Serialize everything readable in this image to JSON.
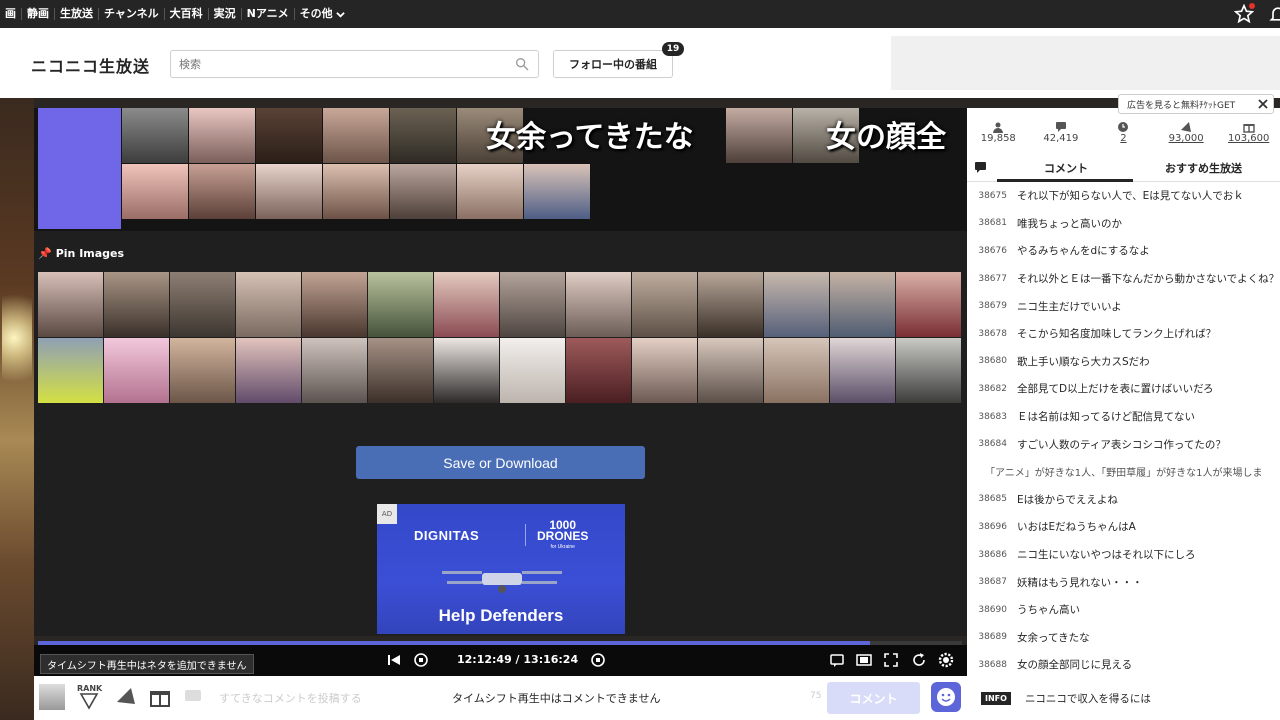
{
  "nav": {
    "items": [
      "画",
      "静画",
      "生放送",
      "チャンネル",
      "大百科",
      "実況",
      "Nアニメ",
      "その他"
    ]
  },
  "header": {
    "logo": "ニコニコ生放送",
    "search_placeholder": "検索",
    "follow_label": "フォロー中の番組",
    "follow_count": "19"
  },
  "player": {
    "overlay_text_1": "女余ってきたな",
    "overlay_text_2": "女の顔全",
    "pin_label": "Pin Images",
    "save_label": "Save or Download",
    "ad": {
      "tag": "AD",
      "brand": "DIGNITAS",
      "drones_line1": "1000",
      "drones_line2": "DRONES",
      "drones_sub": "for Ukraine",
      "tagline": "Help Defenders"
    },
    "progress": 0.9,
    "time": "12:12:49 / 13:16:24",
    "tooltip": "タイムシフト再生中はネタを追加できません"
  },
  "bottom": {
    "rank": "RANK",
    "comment_placeholder": "すてきなコメントを投稿する",
    "no_comment": "タイムシフト再生中はコメントできません",
    "char_count": "75",
    "comment_button": "コメント"
  },
  "side": {
    "ad_ticket": "広告を見ると無料ﾁｹｯﾄGET",
    "stats": [
      {
        "icon": "viewer-icon",
        "value": "19,858"
      },
      {
        "icon": "comment-count-icon",
        "value": "42,419"
      },
      {
        "icon": "timeshift-icon",
        "value": "2"
      },
      {
        "icon": "ad-points-icon",
        "value": "93,000"
      },
      {
        "icon": "gift-icon",
        "value": "103,600"
      }
    ],
    "tabs": [
      "コメント",
      "おすすめ生放送"
    ],
    "comments": [
      {
        "no": "38675",
        "text": "それ以下が知らない人で、Eは見てない人でおｋ"
      },
      {
        "no": "38681",
        "text": "唯我ちょっと高いのか"
      },
      {
        "no": "38676",
        "text": "やるみちゃんをdにするなよ"
      },
      {
        "no": "38677",
        "text": "それ以外とＥは一番下なんだから動かさないでよくね？"
      },
      {
        "no": "38679",
        "text": "ニコ生主だけでいいよ"
      },
      {
        "no": "38678",
        "text": "そこから知名度加味してランク上げれば？"
      },
      {
        "no": "38680",
        "text": "歌上手い順なら大カスSだわ"
      },
      {
        "no": "38682",
        "text": "全部見てD以上だけを表に置けばいいだろ"
      },
      {
        "no": "38683",
        "text": "Ｅは名前は知ってるけど配信見てない"
      },
      {
        "no": "38684",
        "text": "すごい人数のティア表シコシコ作ってたの？"
      },
      {
        "no": "",
        "text": "「アニメ」が好きな1人、「野田草履」が好きな1人が来場しま"
      },
      {
        "no": "38685",
        "text": "Eは後からでええよね"
      },
      {
        "no": "38696",
        "text": "いおはEだねうちゃんはA"
      },
      {
        "no": "38686",
        "text": "ニコ生にいないやつはそれ以下にしろ"
      },
      {
        "no": "38687",
        "text": "妖精はもう見れない・・・"
      },
      {
        "no": "38690",
        "text": "うちゃん高い"
      },
      {
        "no": "38689",
        "text": "女余ってきたな"
      },
      {
        "no": "38688",
        "text": "女の顔全部同じに見える"
      }
    ],
    "info_tag": "INFO",
    "info_text": "ニコニコで収入を得るには"
  },
  "colors": {
    "accent": "#5c66d8",
    "save_button": "#4a6eb6",
    "topnav": "#252525",
    "purple_block": "#6f66e8"
  }
}
